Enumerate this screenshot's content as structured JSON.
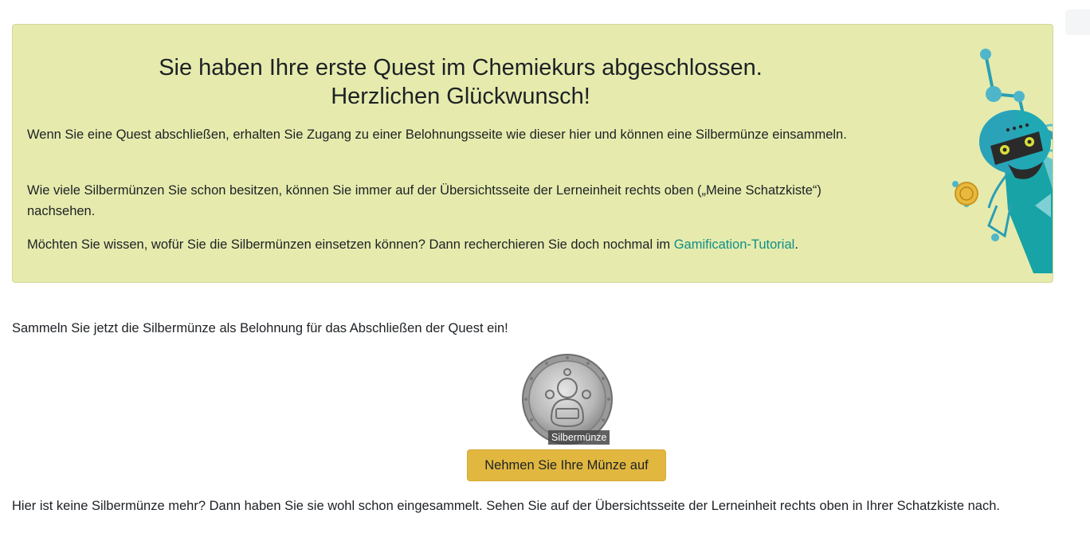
{
  "banner": {
    "title_line1": "Sie haben Ihre erste Quest im Chemiekurs abgeschlossen.",
    "title_line2": "Herzlichen Glückwunsch!",
    "paragraph1": "Wenn Sie eine Quest abschließen, erhalten Sie Zugang zu einer Belohnungsseite wie dieser hier und können eine Silbermünze einsammeln.",
    "paragraph2": "Wie viele Silbermünzen Sie schon besitzen, können Sie immer auf der Übersichtsseite der Lerneinheit rechts oben („Meine Schatzkiste“) nachsehen.",
    "paragraph3_before": "Möchten Sie wissen, wofür Sie die Silbermünzen einsetzen können? Dann recherchieren Sie doch nochmal im ",
    "paragraph3_link": "Gamification-Tutorial",
    "paragraph3_after": "."
  },
  "collect": {
    "intro": "Sammeln Sie jetzt die Silbermünze als Belohnung für das Abschließen der Quest ein!",
    "coin_tooltip": "Silbermünze",
    "button_label": "Nehmen Sie Ihre Münze auf",
    "hint": "Hier ist keine Silbermünze mehr? Dann haben Sie sie wohl schon eingesammelt. Sehen Sie auf der Übersichtsseite der Lerneinheit rechts oben in Ihrer Schatzkiste nach."
  },
  "colors": {
    "banner_bg": "#e6ebad",
    "link": "#0f8f87",
    "button_bg": "#e1b740",
    "robot_teal": "#17a2a2"
  },
  "icons": {
    "robot": "robot-mascot-icon",
    "coin": "silver-coin-icon"
  }
}
